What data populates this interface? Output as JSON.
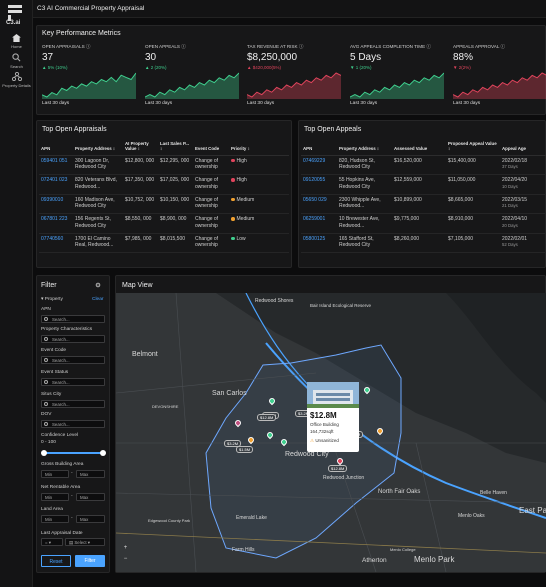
{
  "app": {
    "title": "C3 AI Commercial Property Appraisal",
    "logo_text": "C3.ai"
  },
  "rail": [
    {
      "label": "Home",
      "icon": "home-icon"
    },
    {
      "label": "Search",
      "icon": "search-icon"
    },
    {
      "label": "Property Details",
      "icon": "tree-icon"
    }
  ],
  "kpi": {
    "title": "Key Performance Metrics",
    "cards": [
      {
        "label": "OPEN APPRAISALS ⓘ",
        "value": "37",
        "delta": "▲ 5% (10%)",
        "trend": "up",
        "foot": "Last 30 days",
        "spark": [
          6,
          5,
          7,
          6,
          9,
          8,
          10,
          9,
          11,
          10,
          12,
          11,
          13,
          12,
          14,
          12,
          15,
          14,
          13,
          16
        ]
      },
      {
        "label": "OPEN APPEALS ⓘ",
        "value": "30",
        "delta": "▲ 2 (20%)",
        "trend": "up",
        "foot": "Last 30 days",
        "spark": [
          5,
          6,
          5,
          7,
          6,
          8,
          7,
          9,
          8,
          10,
          9,
          11,
          10,
          12,
          11,
          13,
          12,
          14,
          13,
          15
        ]
      },
      {
        "label": "TAX REVENUE AT RISK ⓘ",
        "value": "$8,250,000",
        "delta": "▲ $420,000(5%)",
        "trend": "down",
        "foot": "Last 30 days",
        "spark": [
          7,
          6,
          8,
          7,
          9,
          8,
          10,
          9,
          11,
          10,
          12,
          11,
          13,
          12,
          14,
          13,
          15,
          14,
          16,
          15
        ]
      },
      {
        "label": "AVG APPEALS COMPLETION TIME ⓘ",
        "value": "5 Days",
        "delta": "▼ 1 (20%)",
        "trend": "up",
        "foot": "Last 30 days",
        "spark": [
          6,
          7,
          6,
          8,
          7,
          9,
          8,
          10,
          9,
          11,
          10,
          12,
          11,
          13,
          12,
          14,
          13,
          15,
          14,
          16
        ]
      },
      {
        "label": "APPEALS APPROVAL ⓘ",
        "value": "88%",
        "delta": "▼ 2(2%)",
        "trend": "down",
        "foot": "Last 30 days",
        "spark": [
          8,
          7,
          9,
          8,
          10,
          9,
          11,
          10,
          12,
          11,
          13,
          12,
          14,
          13,
          15,
          14,
          16,
          15,
          17,
          16
        ]
      }
    ]
  },
  "appraisals": {
    "title": "Top Open Appraisals",
    "headers": [
      "APN",
      "Property Address",
      "AI Property Value",
      "Last Sales P...",
      "Event Code",
      "Priority"
    ],
    "rows": [
      {
        "apn": "059401 051",
        "address": "300 Lagoon Dr, Redwood City",
        "ai": "$12,800, 000",
        "last": "$12,295, 000",
        "event": "Change of ownership",
        "priority": "High",
        "pcolor": "#e0445c"
      },
      {
        "apn": "072401 023",
        "address": "820 Veterans Blvd, Redwood...",
        "ai": "$17,350, 000",
        "last": "$17,025, 000",
        "event": "Change of ownership",
        "priority": "High",
        "pcolor": "#e0445c"
      },
      {
        "apn": "09390010",
        "address": "160 Madison Ave, Redwood City",
        "ai": "$10,752, 000",
        "last": "$10,150, 000",
        "event": "Change of ownership",
        "priority": "Medium",
        "pcolor": "#f0a030"
      },
      {
        "apn": "067801 223",
        "address": "156 Regents St, Redwood City",
        "ai": "$8,550, 000",
        "last": "$8,900, 000",
        "event": "Change of ownership",
        "priority": "Medium",
        "pcolor": "#f0a030"
      },
      {
        "apn": "07740560",
        "address": "1700 El Camino Real, Redwood...",
        "ai": "$7,985, 000",
        "last": "$8,015,500",
        "event": "Change of ownership",
        "priority": "Low",
        "pcolor": "#3fcf8e"
      }
    ]
  },
  "appeals": {
    "title": "Top Open Appeals",
    "headers": [
      "APN",
      "Property Address",
      "Assessed Value",
      "Proposed Appeal Value",
      "Appeal Age"
    ],
    "rows": [
      {
        "apn": "07469229",
        "address": "820, Hudson St, Redwood City",
        "assessed": "$16,520,000",
        "proposed": "$15,400,000",
        "date": "2022/02/18",
        "age": "37 Days"
      },
      {
        "apn": "09120055",
        "address": "55 Hopkins Ave, Redwood City",
        "assessed": "$12,559,000",
        "proposed": "$11,050,000",
        "date": "2022/04/20",
        "age": "10 Days"
      },
      {
        "apn": "05650 029",
        "address": "2300 Whipple Ave, Redwood...",
        "assessed": "$10,899,000",
        "proposed": "$8,665,000",
        "date": "2022/03/15",
        "age": "21 Days"
      },
      {
        "apn": "06259001",
        "address": "10 Brewester Ave, Redwood...",
        "assessed": "$9,775,000",
        "proposed": "$8,910,000",
        "date": "2022/04/10",
        "age": "20 Days"
      },
      {
        "apn": "05800125",
        "address": "165 Stafford St, Redwood City",
        "assessed": "$8,260,000",
        "proposed": "$7,105,000",
        "date": "2022/02/01",
        "age": "52 Days"
      }
    ]
  },
  "filter": {
    "title": "Filter",
    "section": "Property",
    "clear": "Clear",
    "search_placeholder": "Search...",
    "fields": [
      "APN",
      "Property Characteristics",
      "Event Code",
      "Event Status",
      "Situs City",
      "DOV"
    ],
    "confidence_label": "Confidence Level",
    "confidence_range": "0 - 100",
    "range_fields": [
      "Gross Building Area",
      "Net Rentable Area",
      "Land Area"
    ],
    "min": "Min",
    "max": "Max",
    "last_appraisal": "Last Appraisal Date",
    "select": "Select",
    "reset": "Reset",
    "apply": "Filter"
  },
  "map": {
    "title": "Map View",
    "places": {
      "belmont": "Belmont",
      "san_carlos": "San Carlos",
      "redwood_city": "Redwood City",
      "redwood_shores": "Redwood Shores",
      "bair_island": "Bair Island Ecological Reserve",
      "atherton": "Atherton",
      "menlo_park": "Menlo Park",
      "north_fair_oaks": "North Fair Oaks",
      "east_pa": "East Pa",
      "redwood_junction": "Redwood Junction",
      "emerald_lake": "Emerald Lake",
      "farm_hills": "Farm Hills",
      "devonshire": "DEVONSHIRE",
      "edgewood": "Edgewood County Park",
      "belle_haven": "Belle Haven",
      "menlo_oaks": "Menlo Oaks",
      "menlo_college": "Menlo College"
    },
    "popup": {
      "value": "$12.8M",
      "type": "Office Building",
      "size": "164,732sqft",
      "status": "Unsanitized"
    },
    "pins": [
      "$3.2M",
      "$3.2M",
      "$12.8M",
      "$12.8M",
      "$3.2M",
      "$3.2M",
      "$1.5M"
    ]
  }
}
